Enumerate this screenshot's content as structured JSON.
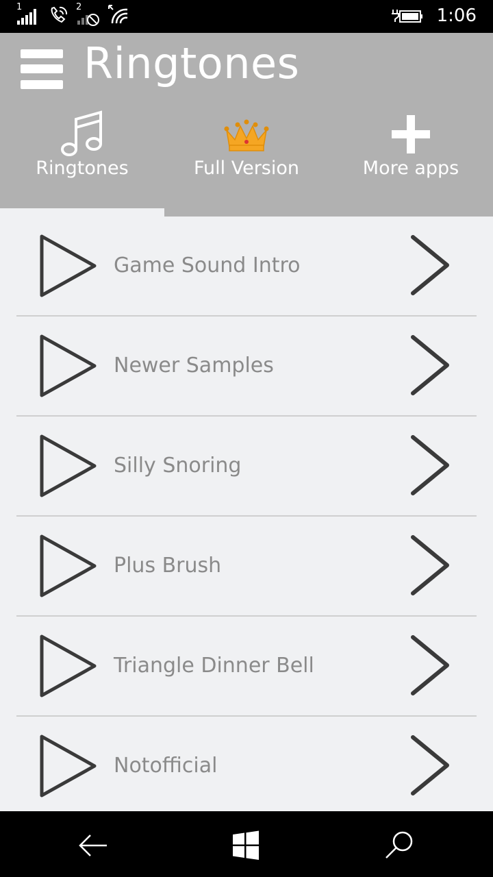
{
  "status_bar": {
    "sim1_label": "1",
    "sim2_label": "2",
    "time": "1:06"
  },
  "header": {
    "title": "Ringtones",
    "menu_icon": "hamburger-menu-icon"
  },
  "tabs": [
    {
      "label": "Ringtones",
      "icon": "music-note-icon",
      "selected": true
    },
    {
      "label": "Full Version",
      "icon": "crown-icon",
      "selected": false
    },
    {
      "label": "More apps",
      "icon": "plus-icon",
      "selected": false
    }
  ],
  "list": {
    "items": [
      {
        "title": "Game Sound Intro"
      },
      {
        "title": "Newer Samples"
      },
      {
        "title": "Silly Snoring"
      },
      {
        "title": "Plus Brush"
      },
      {
        "title": "Triangle Dinner Bell"
      },
      {
        "title": "Notofficial"
      }
    ]
  },
  "nav_bar": {
    "back_icon": "back-arrow-icon",
    "home_icon": "windows-logo-icon",
    "search_icon": "search-icon"
  },
  "colors": {
    "header_bg": "#b1b1b1",
    "list_bg": "#f0f1f3",
    "item_text": "#8a8a8a",
    "icon_stroke": "#3a3a3a",
    "crown_gold": "#f5a623"
  }
}
